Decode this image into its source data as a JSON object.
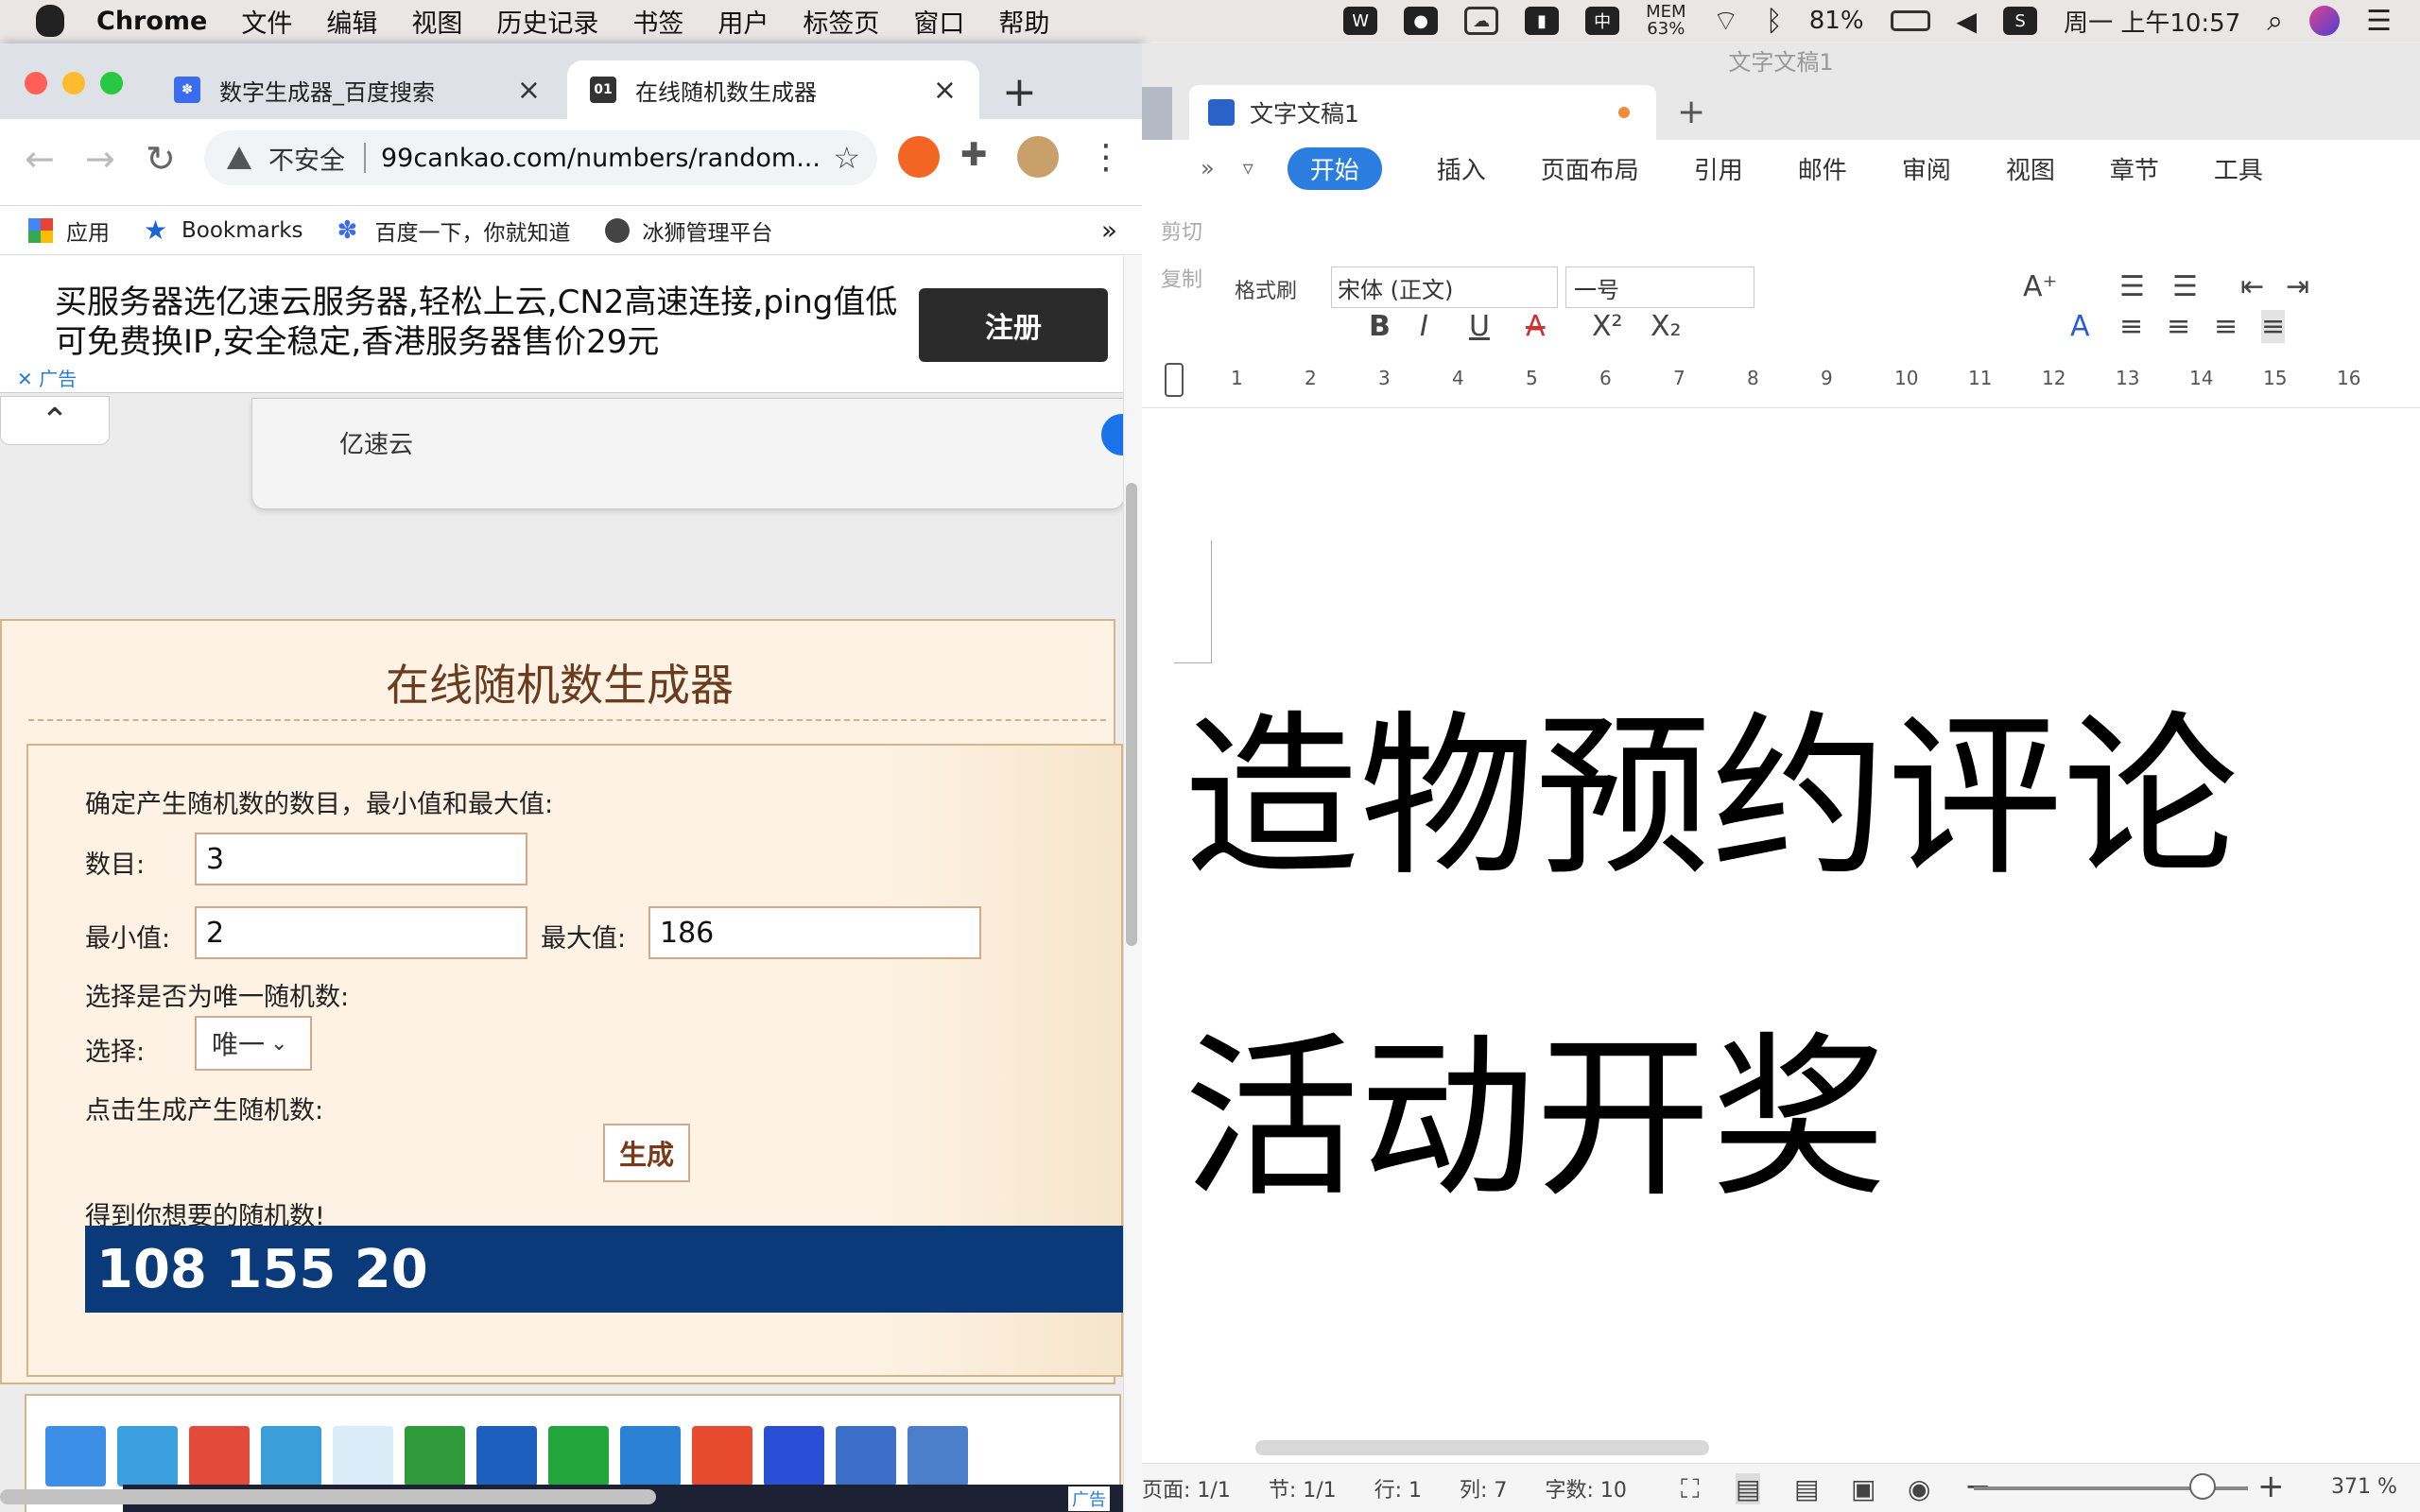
{
  "menubar": {
    "app": "Chrome",
    "items": [
      "文件",
      "编辑",
      "视图",
      "历史记录",
      "书签",
      "用户",
      "标签页",
      "窗口",
      "帮助"
    ],
    "mem": "MEM",
    "mem_val": "63%",
    "battery": "81%",
    "clock": "周一 上午10:57"
  },
  "chrome": {
    "tabs": [
      {
        "title": "数字生成器_百度搜索"
      },
      {
        "title": "在线随机数生成器",
        "favicon": "01"
      }
    ],
    "omnibox": {
      "security": "不安全",
      "url": "99cankao.com/numbers/random..."
    },
    "bookmarks": [
      "应用",
      "Bookmarks",
      "百度一下，你就知道",
      "冰狮管理平台"
    ],
    "more": "»"
  },
  "ad": {
    "text": "买服务器选亿速云服务器,轻松上云,CN2高速连接,ping值低可免费换IP,安全稳定,香港服务器售价29元",
    "button": "注册",
    "label": "广告"
  },
  "card": {
    "name": "亿速云"
  },
  "generator": {
    "title": "在线随机数生成器",
    "prompt": "确定产生随机数的数目，最小值和最大值:",
    "count_label": "数目:",
    "count_value": "3",
    "min_label": "最小值:",
    "min_value": "2",
    "max_label": "最大值:",
    "max_value": "186",
    "unique_prompt": "选择是否为唯一随机数:",
    "select_label": "选择:",
    "select_value": "唯一",
    "click_prompt": "点击生成产生随机数:",
    "button": "生成",
    "result_label": "得到你想要的随机数!",
    "result": "108 155 20"
  },
  "share_ad": "广告",
  "wps": {
    "window_title": "文字文稿1",
    "tab": "文字文稿1",
    "ribbon": [
      "开始",
      "插入",
      "页面布局",
      "引用",
      "邮件",
      "审阅",
      "视图",
      "章节",
      "工具"
    ],
    "clipboard": {
      "cut": "剪切",
      "copy": "复制",
      "format_painter": "格式刷"
    },
    "font": "宋体 (正文)",
    "size": "一号",
    "ruler": [
      "1",
      "2",
      "3",
      "4",
      "5",
      "6",
      "7",
      "8",
      "9",
      "10",
      "11",
      "12",
      "13",
      "14",
      "15",
      "16"
    ],
    "doc_line1": "造物预约评论",
    "doc_line2": "活动开奖",
    "status": {
      "page": "页面: 1/1",
      "section": "节: 1/1",
      "row": "行: 1",
      "col": "列: 7",
      "words": "字数: 10",
      "zoom": "371 %"
    }
  }
}
